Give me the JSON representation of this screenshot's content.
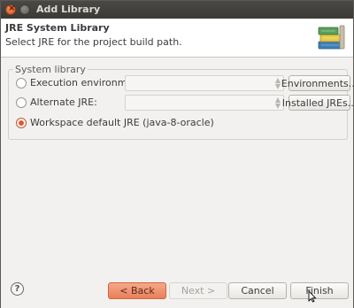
{
  "window": {
    "title": "Add Library",
    "close_symbol": "×"
  },
  "header": {
    "title": "JRE System Library",
    "subtitle": "Select JRE for the project build path.",
    "icon": "books-icon"
  },
  "group": {
    "label": "System library",
    "options": [
      {
        "label": "Execution environment:",
        "selected": false,
        "combo_value": "",
        "button": "Environments..."
      },
      {
        "label": "Alternate JRE:",
        "selected": false,
        "combo_value": "",
        "button": "Installed JREs..."
      },
      {
        "label": "Workspace default JRE (java-8-oracle)",
        "selected": true
      }
    ]
  },
  "footer": {
    "help_symbol": "?",
    "back": "< Back",
    "next": "Next >",
    "cancel": "Cancel",
    "finish": "Finish"
  },
  "colors": {
    "accent": "#e05a2b",
    "titlebar": "#3b3a36"
  }
}
